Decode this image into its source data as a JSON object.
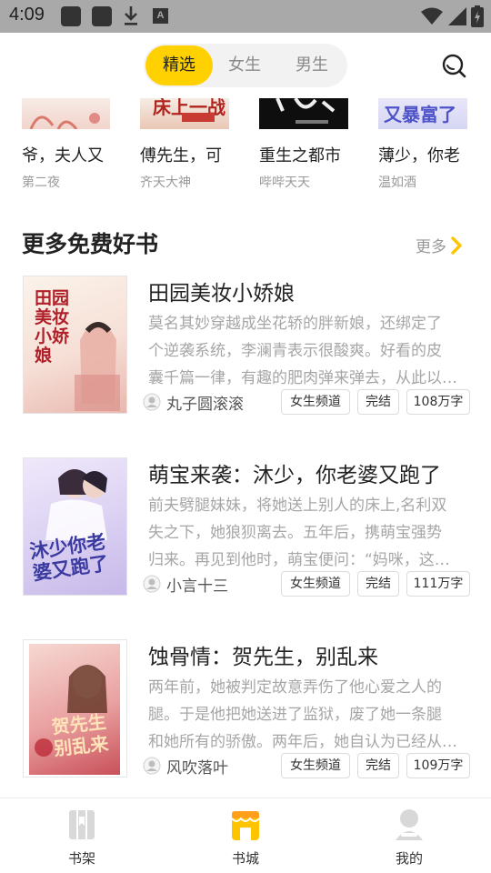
{
  "status_bar": {
    "time": "4:09",
    "a_glyph": "A"
  },
  "tabs": [
    {
      "label": "精选"
    },
    {
      "label": "女生"
    },
    {
      "label": "男生"
    }
  ],
  "strip": [
    {
      "title": "爷，夫人又",
      "author": "第二夜",
      "cover_text": ""
    },
    {
      "title": "傅先生，可",
      "author": "齐天大神",
      "cover_text": "床上一战"
    },
    {
      "title": "重生之都市",
      "author": "哔哔天天",
      "cover_text": ""
    },
    {
      "title": "薄少，你老",
      "author": "温如酒",
      "cover_text": "又暴富了"
    }
  ],
  "section": {
    "title": "更多免费好书",
    "more": "更多"
  },
  "books": [
    {
      "title": "田园美妆小娇娘",
      "desc": [
        "莫名其妙穿越成坐花轿的胖新娘，还绑定了",
        "个逆袭系统，李澜青表示很酸爽。好看的皮",
        "囊千篇一律，有趣的肥肉弹来弹去，从此以…"
      ],
      "author": "丸子圆滚滚",
      "channel": "女生频道",
      "status": "完结",
      "words": "108万字",
      "cover_text": "田园美妆小娇娘"
    },
    {
      "title": "萌宝来袭：沐少，你老婆又跑了",
      "desc": [
        "前夫劈腿妹妹，将她送上别人的床上,名利双",
        "失之下，她狼狈离去。五年后，携萌宝强势",
        "归来。再见到他时，萌宝便问：“妈咪，这…"
      ],
      "author": "小言十三",
      "channel": "女生频道",
      "status": "完结",
      "words": "111万字",
      "cover_text": "沐少你老婆又跑了"
    },
    {
      "title": "蚀骨情：贺先生，别乱来",
      "desc": [
        "两年前，她被判定故意弄伤了他心爱之人的",
        "腿。于是他把她送进了监狱，废了她一条腿",
        "和她所有的骄傲。两年后，她自认为已经从…"
      ],
      "author": "风吹落叶",
      "channel": "女生频道",
      "status": "完结",
      "words": "109万字",
      "cover_text": "贺先生别乱来"
    }
  ],
  "bottom_nav": [
    {
      "label": "书架",
      "icon": "bookshelf-icon"
    },
    {
      "label": "书城",
      "icon": "bookstore-icon",
      "active": true
    },
    {
      "label": "我的",
      "icon": "profile-icon"
    }
  ],
  "colors": {
    "accent": "#ffd100",
    "status_bar": "#a9a9a9",
    "muted": "#a6a6a6"
  }
}
